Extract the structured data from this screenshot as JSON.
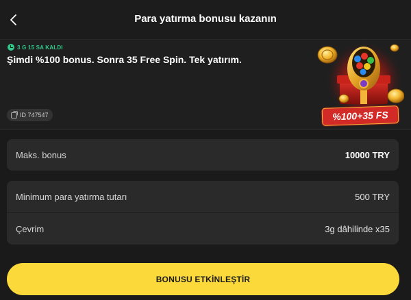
{
  "header": {
    "title": "Para yatırma bonusu kazanın"
  },
  "promo": {
    "timer": "3 G 15 SA KALDI",
    "description": "Şimdi %100 bonus. Sonra 35 Free Spin. Tek yatırım.",
    "id_label": "ID 747547",
    "badge_text": "%100+35 FS"
  },
  "details": {
    "max_bonus": {
      "label": "Maks. bonus",
      "value": "10000 TRY"
    },
    "min_deposit": {
      "label": "Minimum para yatırma tutarı",
      "value": "500 TRY"
    },
    "wagering": {
      "label": "Çevrim",
      "value": "3g dâhilinde x35"
    }
  },
  "cta": {
    "label": "BONUSU ETKİNLEŞTİR"
  },
  "colors": {
    "accent": "#fcd93b",
    "timer": "#2fc98a",
    "background": "#1a1a1a",
    "card": "#2a2a2a"
  }
}
